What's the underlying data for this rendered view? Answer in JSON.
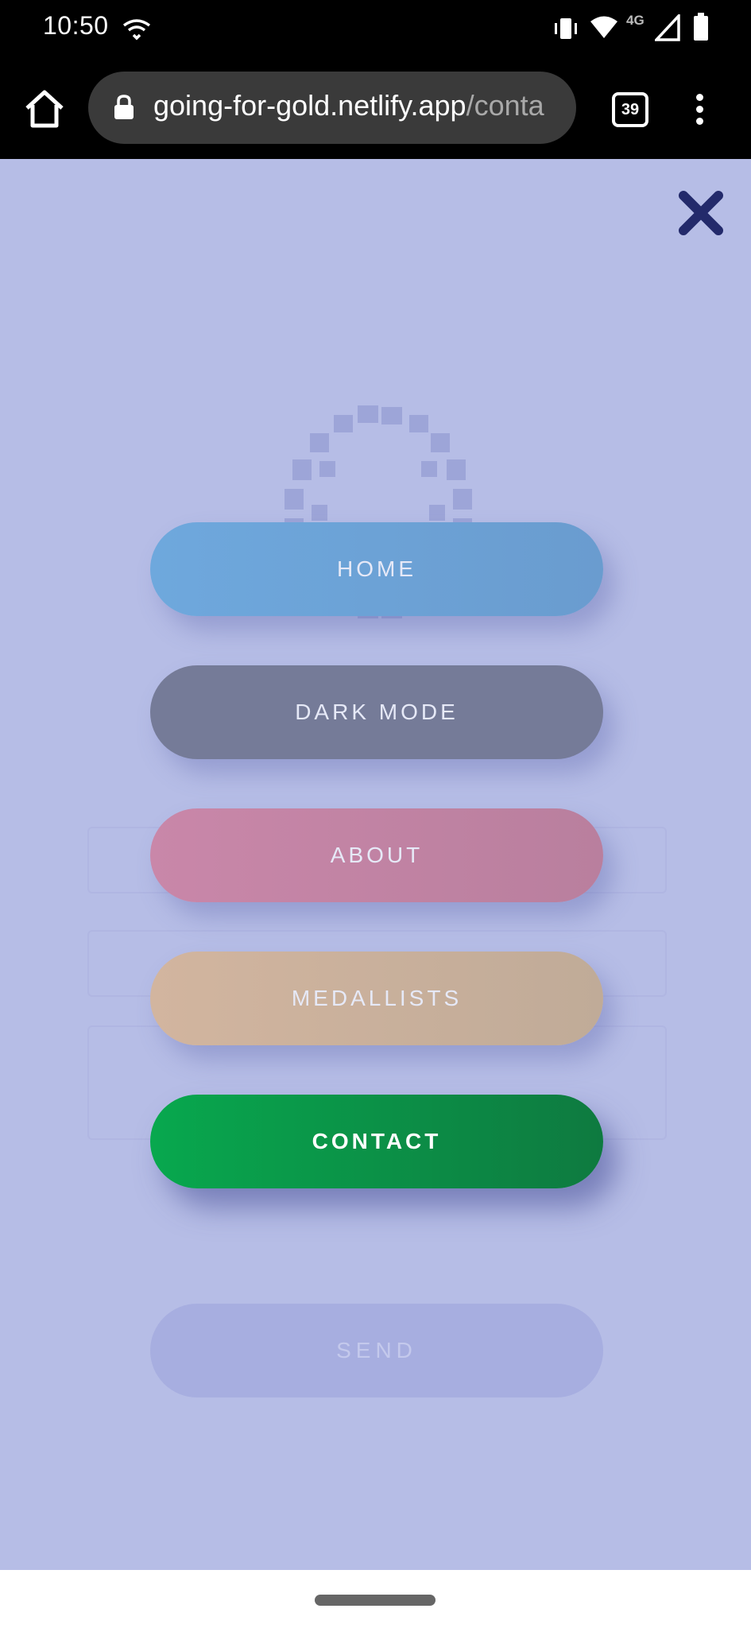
{
  "status_bar": {
    "time": "10:50",
    "network_label": "4G",
    "icons": [
      "hotspot-icon",
      "vibrate-icon",
      "wifi-icon",
      "signal-icon",
      "battery-icon"
    ]
  },
  "browser": {
    "url_domain": "going-for-gold.netlify.app",
    "url_path": "/conta",
    "tab_count": "39",
    "icons": [
      "home-icon",
      "lock-icon",
      "more-vert-icon"
    ]
  },
  "menu": {
    "close_icon": "close-icon",
    "items": [
      {
        "label": "HOME"
      },
      {
        "label": "DARK MODE"
      },
      {
        "label": "ABOUT"
      },
      {
        "label": "MEDALLISTS"
      },
      {
        "label": "CONTACT",
        "active": true
      }
    ]
  },
  "background_form": {
    "send_label": "SEND"
  },
  "colors": {
    "overlay": "#b6bde6",
    "home": "#6ea8dd",
    "dark_mode": "#757b98",
    "about": "#c987a9",
    "medallists": "#d2b59f",
    "contact": "#08a84e",
    "close": "#232a6b"
  }
}
